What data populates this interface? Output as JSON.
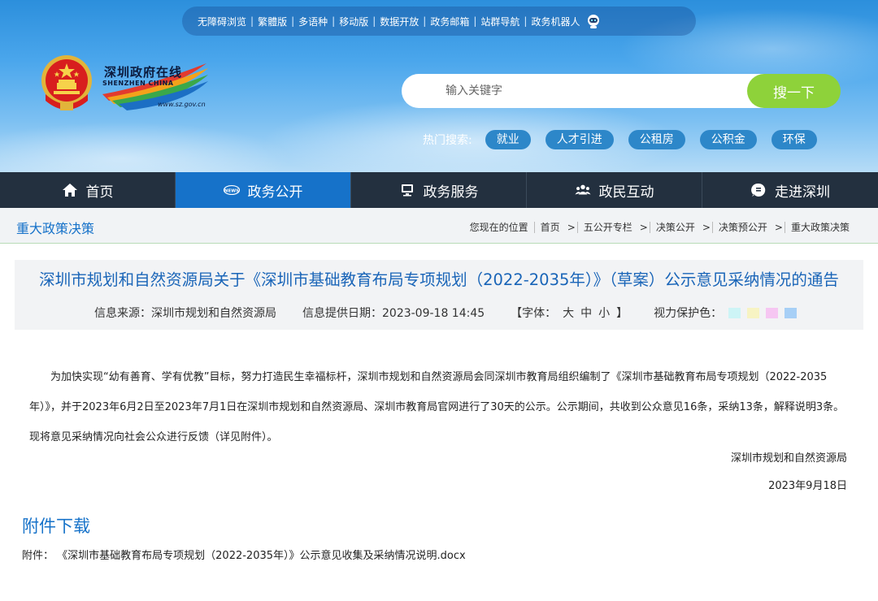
{
  "top_links": [
    "无障碍浏览",
    "繁體版",
    "多语种",
    "移动版",
    "数据开放",
    "政务邮箱",
    "站群导航",
    "政务机器人"
  ],
  "logo": {
    "cn": "深圳政府在线",
    "en": "SHENZHEN CHINA",
    "url": "www.sz.gov.cn"
  },
  "search": {
    "placeholder": "输入关键字",
    "button": "搜一下"
  },
  "hot_search": {
    "label": "热门搜索:",
    "tags": [
      "就业",
      "人才引进",
      "公租房",
      "公积金",
      "环保"
    ]
  },
  "nav": [
    {
      "label": "首页",
      "icon": "home-icon"
    },
    {
      "label": "政务公开",
      "icon": "news-icon"
    },
    {
      "label": "政务服务",
      "icon": "monitor-icon"
    },
    {
      "label": "政民互动",
      "icon": "people-icon"
    },
    {
      "label": "走进深圳",
      "icon": "info-icon"
    }
  ],
  "section": "重大政策决策",
  "breadcrumb": {
    "label": "您现在的位置",
    "items": [
      "首页",
      "五公开专栏",
      "决策公开",
      "决策预公开",
      "重大政策决策"
    ]
  },
  "article": {
    "title": "深圳市规划和自然资源局关于《深圳市基础教育布局专项规划（2022-2035年）》（草案）公示意见采纳情况的通告",
    "source": "信息来源：深圳市规划和自然资源局",
    "date": "信息提供日期：2023-09-18 14:45",
    "font_label": "【字体：",
    "font_sizes": [
      "大",
      "中",
      "小"
    ],
    "font_close": "】",
    "eye_label": "视力保护色：",
    "eye_colors": [
      "#cdf4f6",
      "#f7f3c3",
      "#f6c6f2",
      "#a7cff6"
    ],
    "paragraph": "为加快实现“幼有善育、学有优教”目标，努力打造民生幸福标杆，深圳市规划和自然资源局会同深圳市教育局组织编制了《深圳市基础教育布局专项规划（2022-2035年）》，并于2023年6月2日至2023年7月1日在深圳市规划和自然资源局、深圳市教育局官网进行了30天的公示。公示期间，共收到公众意见16条，采纳13条，解释说明3条。现将意见采纳情况向社会公众进行反馈（详见附件）。",
    "sign_org": "深圳市规划和自然资源局",
    "sign_date": "2023年9月18日"
  },
  "attachment": {
    "title": "附件下载",
    "prefix": "附件：",
    "file": "《深圳市基础教育布局专项规划（2022-2035年）》公示意见收集及采纳情况说明.docx"
  }
}
